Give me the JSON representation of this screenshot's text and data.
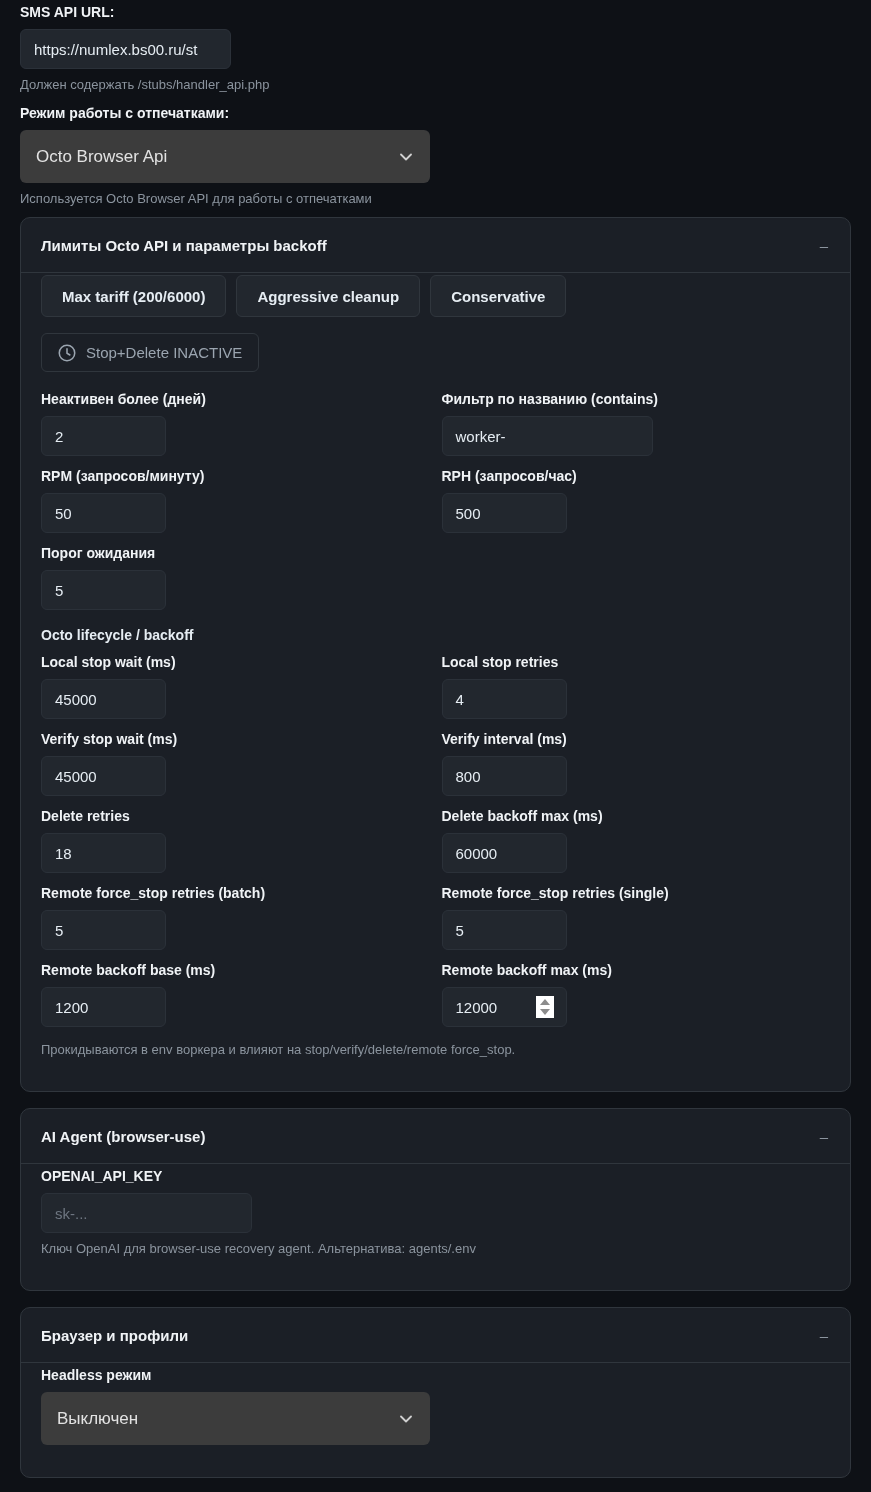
{
  "settings": [
    {
      "label": "SMS API URL:",
      "kind": "text",
      "value": "https://numlex.bs00.ru/st",
      "hint": "Должен содержать /stubs/handler_api.php"
    },
    {
      "label": "Режим работы с отпечатками:",
      "kind": "select",
      "value": "Octo Browser Api",
      "hint": "Используется Octo Browser API для работы с отпечатками"
    }
  ],
  "panels": [
    {
      "title": "Лимиты Octo API и параметры backoff",
      "toggle": "–",
      "blocks": [
        {
          "kind": "presets",
          "buttons": [
            "Max tariff (200/6000)",
            "Aggressive cleanup",
            "Conservative"
          ]
        },
        {
          "kind": "action",
          "label": "Stop+Delete INACTIVE"
        },
        {
          "kind": "grid",
          "fields": [
            {
              "label": "Неактивен более (дней)",
              "kind": "number",
              "value": "2",
              "hovered": false
            },
            {
              "label": "Фильтр по названию (contains)",
              "kind": "text",
              "value": "worker-",
              "hovered": false
            },
            {
              "label": "RPM (запросов/минуту)",
              "kind": "number",
              "value": "50",
              "hovered": false
            },
            {
              "label": "RPH (запросов/час)",
              "kind": "number",
              "value": "500",
              "hovered": false
            },
            {
              "label": "Порог ожидания",
              "kind": "number",
              "value": "5",
              "hovered": false
            }
          ]
        },
        {
          "kind": "heading",
          "text": "Octo lifecycle / backoff"
        },
        {
          "kind": "grid",
          "fields": [
            {
              "label": "Local stop wait (ms)",
              "kind": "number",
              "value": "45000",
              "hovered": false
            },
            {
              "label": "Local stop retries",
              "kind": "number",
              "value": "4",
              "hovered": false
            },
            {
              "label": "Verify stop wait (ms)",
              "kind": "number",
              "value": "45000",
              "hovered": false
            },
            {
              "label": "Verify interval (ms)",
              "kind": "number",
              "value": "800",
              "hovered": false
            },
            {
              "label": "Delete retries",
              "kind": "number",
              "value": "18",
              "hovered": false
            },
            {
              "label": "Delete backoff max (ms)",
              "kind": "number",
              "value": "60000",
              "hovered": false
            },
            {
              "label": "Remote force_stop retries (batch)",
              "kind": "number",
              "value": "5",
              "hovered": false
            },
            {
              "label": "Remote force_stop retries (single)",
              "kind": "number",
              "value": "5",
              "hovered": false
            },
            {
              "label": "Remote backoff base (ms)",
              "kind": "number",
              "value": "1200",
              "hovered": false
            },
            {
              "label": "Remote backoff max (ms)",
              "kind": "number",
              "value": "12000",
              "hovered": true
            }
          ]
        },
        {
          "kind": "note",
          "text": "Прокидываются в env воркера и влияют на stop/verify/delete/remote force_stop."
        }
      ]
    },
    {
      "title": "AI Agent (browser-use)",
      "toggle": "–",
      "blocks": [
        {
          "kind": "field",
          "field": {
            "label": "OPENAI_API_KEY",
            "kind": "text",
            "placeholder": "sk-...",
            "hint": "Ключ OpenAI для browser-use recovery agent. Альтернатива: agents/.env"
          }
        }
      ]
    },
    {
      "title": "Браузер и профили",
      "toggle": "–",
      "blocks": [
        {
          "kind": "field",
          "field": {
            "label": "Headless режим",
            "kind": "select",
            "value": "Выключен"
          }
        }
      ]
    }
  ]
}
